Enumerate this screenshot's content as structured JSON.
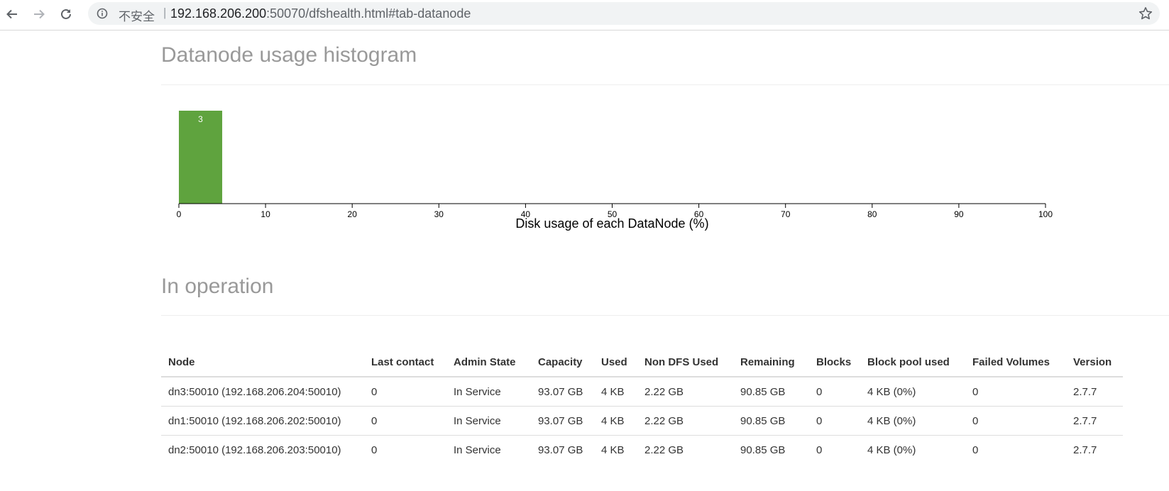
{
  "browser": {
    "insecure_label": "不安全",
    "separator": "|",
    "url_host": "192.168.206.200",
    "url_rest": ":50070/dfshealth.html#tab-datanode",
    "icons": [
      "back-arrow-icon",
      "forward-arrow-icon",
      "reload-icon",
      "info-icon",
      "star-icon"
    ]
  },
  "histogram": {
    "title": "Datanode usage histogram"
  },
  "chart_data": {
    "type": "bar",
    "title": "",
    "xlabel": "Disk usage of each DataNode (%)",
    "ylabel": "",
    "xlim": [
      0,
      100
    ],
    "x_ticks": [
      "0",
      "10",
      "20",
      "30",
      "40",
      "50",
      "60",
      "70",
      "80",
      "90",
      "100"
    ],
    "bins": [
      {
        "start": 0,
        "end": 5,
        "value": 3,
        "label": "3"
      }
    ],
    "bar_color": "#5fa33e",
    "grid": false
  },
  "in_operation": {
    "title": "In operation",
    "columns": [
      "Node",
      "Last contact",
      "Admin State",
      "Capacity",
      "Used",
      "Non DFS Used",
      "Remaining",
      "Blocks",
      "Block pool used",
      "Failed Volumes",
      "Version"
    ],
    "rows": [
      [
        "dn3:50010 (192.168.206.204:50010)",
        "0",
        "In Service",
        "93.07 GB",
        "4 KB",
        "2.22 GB",
        "90.85 GB",
        "0",
        "4 KB (0%)",
        "0",
        "2.7.7"
      ],
      [
        "dn1:50010 (192.168.206.202:50010)",
        "0",
        "In Service",
        "93.07 GB",
        "4 KB",
        "2.22 GB",
        "90.85 GB",
        "0",
        "4 KB (0%)",
        "0",
        "2.7.7"
      ],
      [
        "dn2:50010 (192.168.206.203:50010)",
        "0",
        "In Service",
        "93.07 GB",
        "4 KB",
        "2.22 GB",
        "90.85 GB",
        "0",
        "4 KB (0%)",
        "0",
        "2.7.7"
      ]
    ]
  }
}
